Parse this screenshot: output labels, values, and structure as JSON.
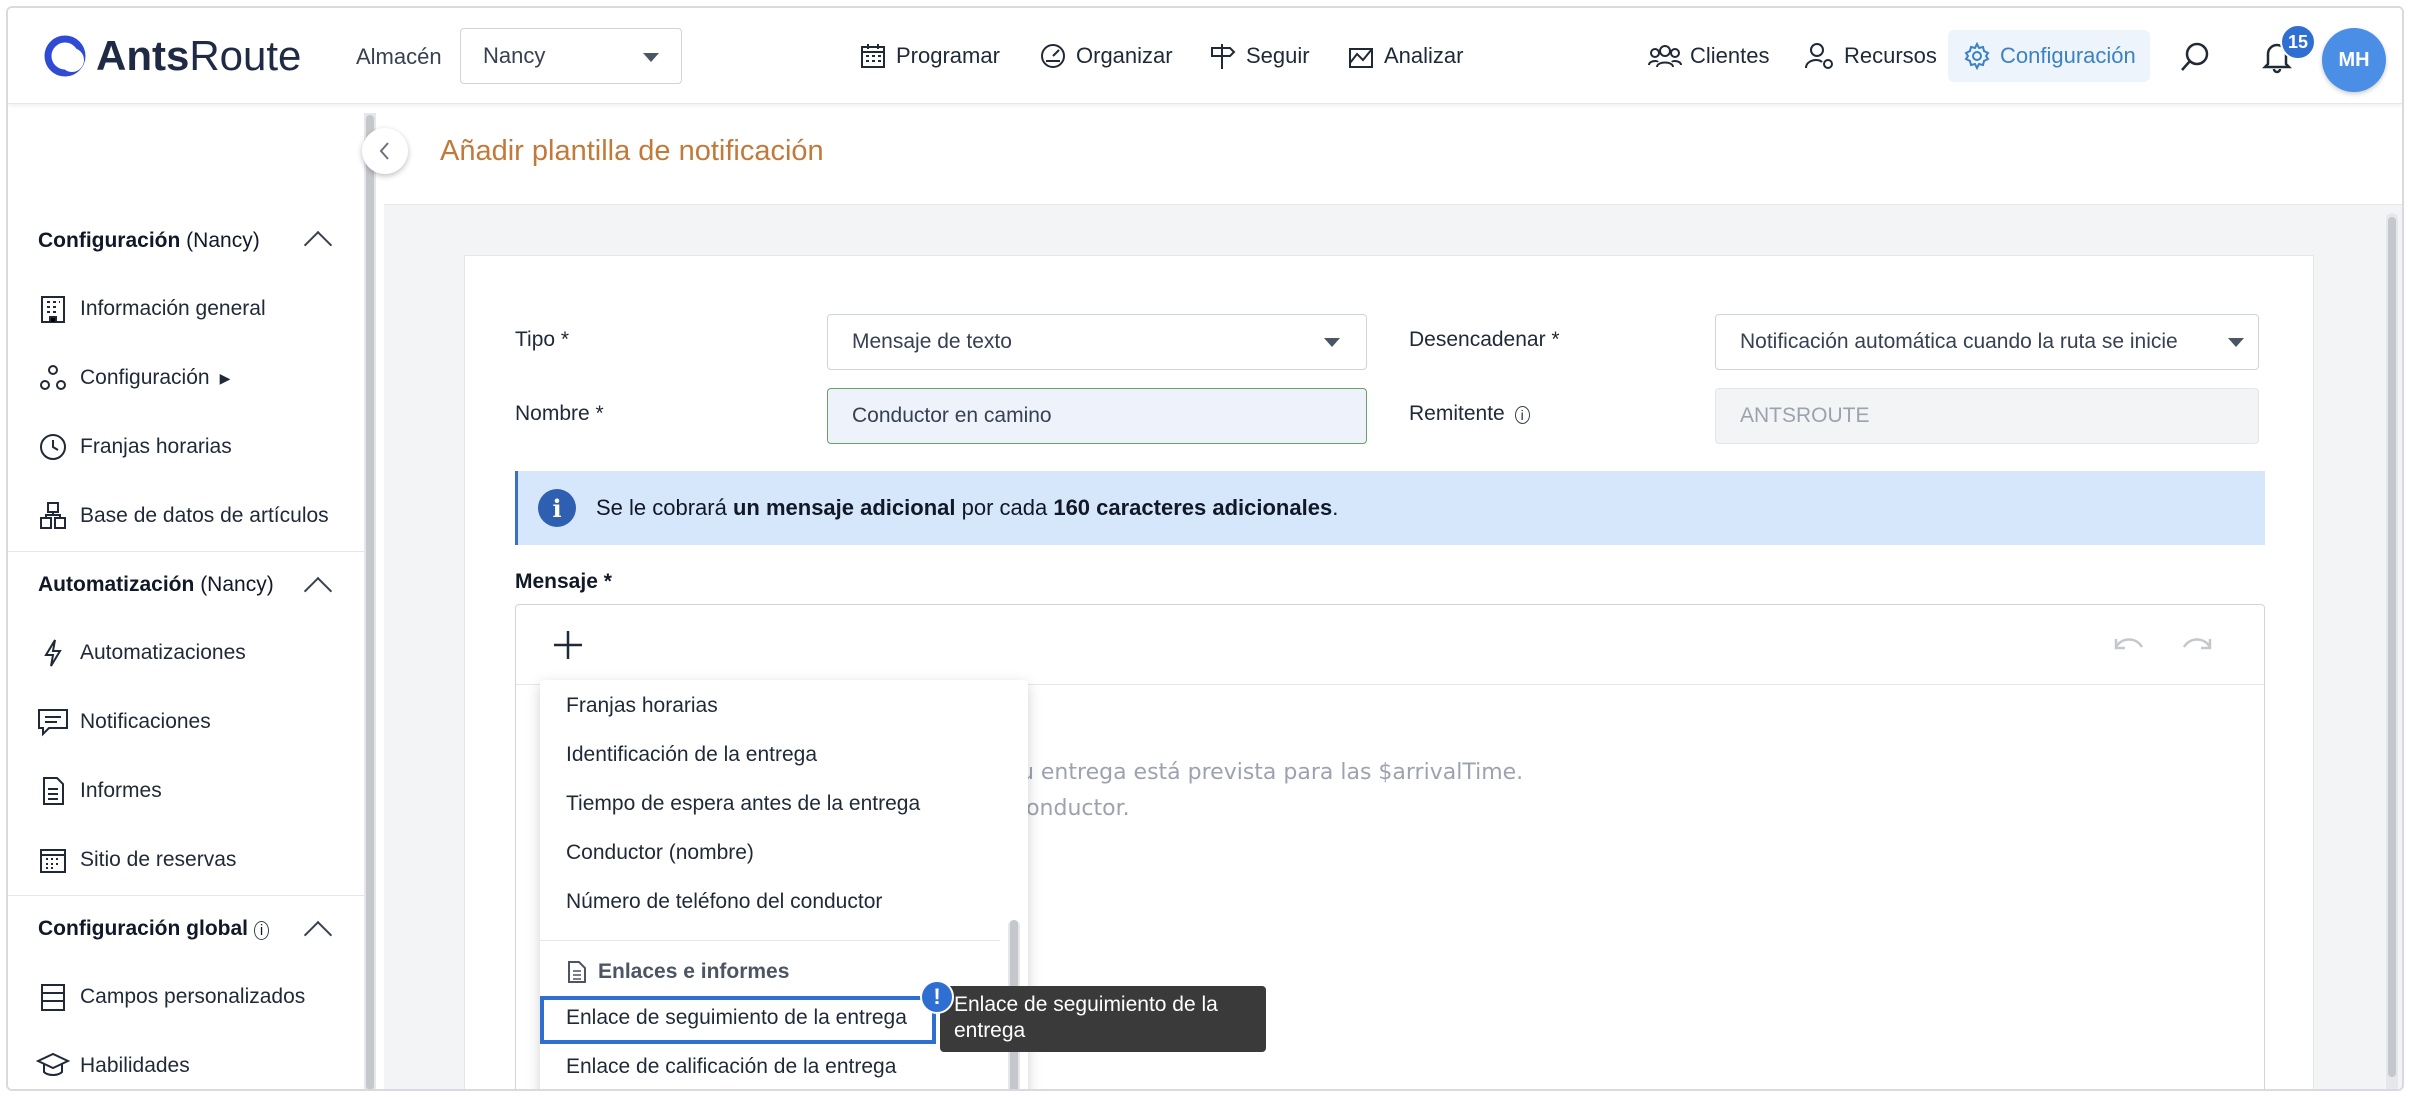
{
  "header": {
    "logo_bold": "Ants",
    "logo_rest": "Route",
    "warehouse_label": "Almacén",
    "warehouse_value": "Nancy",
    "nav": [
      "Programar",
      "Organizar",
      "Seguir",
      "Analizar"
    ],
    "right_nav": [
      "Clientes",
      "Recursos",
      "Configuración"
    ],
    "notif_count": "15",
    "avatar": "MH"
  },
  "sidebar": {
    "sections": [
      {
        "title": "Configuración",
        "suffix": "(Nancy)"
      },
      {
        "title": "Automatización",
        "suffix": "(Nancy)"
      },
      {
        "title": "Configuración global",
        "suffix": ""
      }
    ],
    "items": [
      "Información general",
      "Configuración",
      "Franjas horarias",
      "Base de datos de artículos",
      "Automatizaciones",
      "Notificaciones",
      "Informes",
      "Sitio de reservas",
      "Campos personalizados",
      "Habilidades"
    ]
  },
  "page": {
    "title": "Añadir plantilla de notificación"
  },
  "form": {
    "tipo_label": "Tipo *",
    "tipo_value": "Mensaje de texto",
    "trigger_label": "Desencadenar *",
    "trigger_value": "Notificación automática cuando la ruta se inicie",
    "nombre_label": "Nombre *",
    "nombre_value": "Conductor en camino",
    "remitente_label": "Remitente",
    "remitente_value": "ANTSROUTE",
    "info_pre": "Se le cobrará ",
    "info_b1": "un mensaje adicional",
    "info_mid": " por cada ",
    "info_b2": "160 caracteres adicionales",
    "info_end": ".",
    "mensaje_label": "Mensaje *",
    "editor_line1": "Su entrega está prevista para las $arrivalTime.",
    "editor_line2": "conductor."
  },
  "dropdown": {
    "items": [
      "Franjas horarias",
      "Identificación de la entrega",
      "Tiempo de espera antes de la entrega",
      "Conductor (nombre)",
      "Número de teléfono del conductor"
    ],
    "group_title": "Enlaces e informes",
    "group_items": [
      "Enlace de seguimiento de la entrega",
      "Enlace de calificación de la entrega"
    ],
    "tooltip": "Enlace de seguimiento de la entrega"
  },
  "colors": {
    "accent": "#3b82c4",
    "title": "#c27a3a",
    "info_bg": "#d6e6fb",
    "highlight": "#2f6fd1"
  }
}
